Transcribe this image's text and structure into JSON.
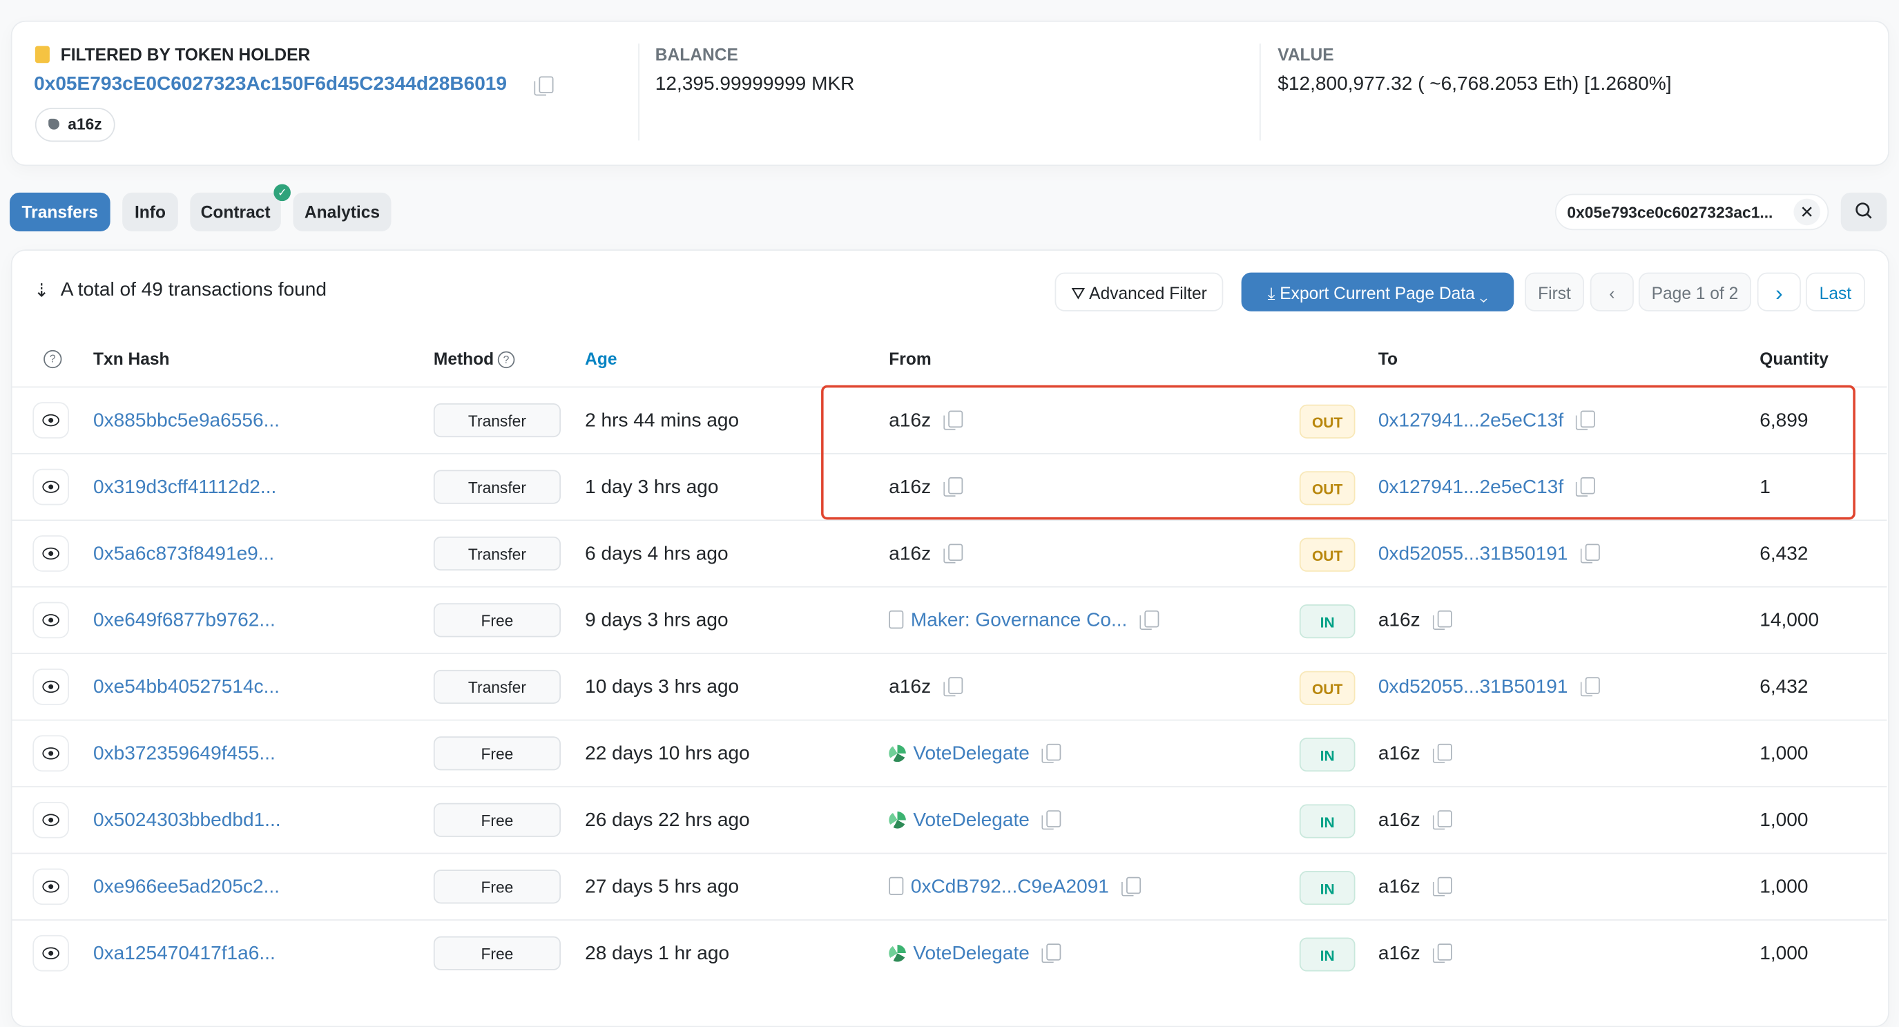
{
  "holder": {
    "label": "FILTERED BY TOKEN HOLDER",
    "address": "0x05E793cE0C6027323Ac150F6d45C2344d28B6019",
    "tag": "a16z",
    "balance_label": "BALANCE",
    "balance": "12,395.99999999 MKR",
    "value_label": "VALUE",
    "value": "$12,800,977.32 ( ~6,768.2053 Eth) [1.2680%]"
  },
  "tabs": [
    {
      "label": "Transfers",
      "active": true
    },
    {
      "label": "Info"
    },
    {
      "label": "Contract",
      "verified": true
    },
    {
      "label": "Analytics"
    }
  ],
  "filter": {
    "value": "0x05e793ce0c6027323ac1..."
  },
  "toolbar": {
    "total": "A total of 49 transactions found",
    "advanced_filter": "Advanced Filter",
    "export": "Export Current Page Data",
    "first": "First",
    "page": "Page 1 of 2",
    "last": "Last"
  },
  "colors": {
    "accent": "#3d7fc1",
    "link": "#3f7fbf",
    "highlight": "#e0452f",
    "out": "#b8860b",
    "in": "#00a186"
  },
  "table": {
    "headers": {
      "txn_hash": "Txn Hash",
      "method": "Method",
      "age": "Age",
      "from": "From",
      "to": "To",
      "quantity": "Quantity"
    },
    "rows": [
      {
        "hash": "0x885bbc5e9a6556...",
        "method": "Transfer",
        "age": "2 hrs 44 mins ago",
        "from": "a16z",
        "from_type": "plain",
        "dir": "OUT",
        "to": "0x127941...2e5eC13f",
        "to_type": "link",
        "qty": "6,899",
        "highlighted": true
      },
      {
        "hash": "0x319d3cff41112d2...",
        "method": "Transfer",
        "age": "1 day 3 hrs ago",
        "from": "a16z",
        "from_type": "plain",
        "dir": "OUT",
        "to": "0x127941...2e5eC13f",
        "to_type": "link",
        "qty": "1",
        "highlighted": true
      },
      {
        "hash": "0x5a6c873f8491e9...",
        "method": "Transfer",
        "age": "6 days 4 hrs ago",
        "from": "a16z",
        "from_type": "plain",
        "dir": "OUT",
        "to": "0xd52055...31B50191",
        "to_type": "link",
        "qty": "6,432"
      },
      {
        "hash": "0xe649f6877b9762...",
        "method": "Free",
        "age": "9 days 3 hrs ago",
        "from": "Maker: Governance Co...",
        "from_type": "contract",
        "dir": "IN",
        "to": "a16z",
        "to_type": "plain",
        "qty": "14,000"
      },
      {
        "hash": "0xe54bb40527514c...",
        "method": "Transfer",
        "age": "10 days 3 hrs ago",
        "from": "a16z",
        "from_type": "plain",
        "dir": "OUT",
        "to": "0xd52055...31B50191",
        "to_type": "link",
        "qty": "6,432"
      },
      {
        "hash": "0xb372359649f455...",
        "method": "Free",
        "age": "22 days 10 hrs ago",
        "from": "VoteDelegate",
        "from_type": "delegate",
        "dir": "IN",
        "to": "a16z",
        "to_type": "plain",
        "qty": "1,000"
      },
      {
        "hash": "0x5024303bbedbd1...",
        "method": "Free",
        "age": "26 days 22 hrs ago",
        "from": "VoteDelegate",
        "from_type": "delegate",
        "dir": "IN",
        "to": "a16z",
        "to_type": "plain",
        "qty": "1,000"
      },
      {
        "hash": "0xe966ee5ad205c2...",
        "method": "Free",
        "age": "27 days 5 hrs ago",
        "from": "0xCdB792...C9eA2091",
        "from_type": "contract",
        "dir": "IN",
        "to": "a16z",
        "to_type": "plain",
        "qty": "1,000"
      },
      {
        "hash": "0xa125470417f1a6...",
        "method": "Free",
        "age": "28 days 1 hr ago",
        "from": "VoteDelegate",
        "from_type": "delegate",
        "dir": "IN",
        "to": "a16z",
        "to_type": "plain",
        "qty": "1,000"
      }
    ]
  }
}
